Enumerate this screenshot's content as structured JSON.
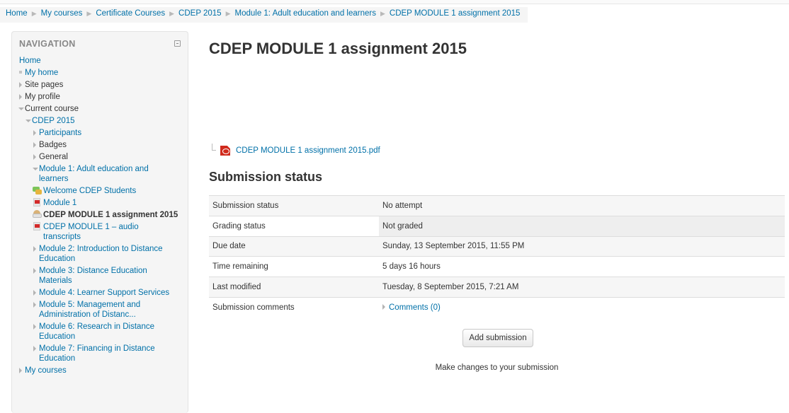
{
  "top": {
    "mini_text": ""
  },
  "breadcrumb": [
    "Home",
    "My courses",
    "Certificate Courses",
    "CDEP 2015",
    "Module 1: Adult education and learners",
    "CDEP MODULE 1 assignment 2015"
  ],
  "navigation": {
    "title": "NAVIGATION",
    "home": "Home",
    "my_home": "My home",
    "site_pages": "Site pages",
    "my_profile": "My profile",
    "current_course": "Current course",
    "course": "CDEP 2015",
    "participants": "Participants",
    "badges": "Badges",
    "general": "General",
    "module1": "Module 1: Adult education and learners",
    "welcome": "Welcome CDEP Students",
    "module1_file": "Module 1",
    "assignment": "CDEP MODULE 1 assignment 2015",
    "audio": "CDEP MODULE 1 – audio transcripts",
    "module2": "Module 2: Introduction to Distance Education",
    "module3": "Module 3: Distance Education Materials",
    "module4": "Module 4: Learner Support Services",
    "module5": "Module 5: Management and Administration of Distanc...",
    "module6": "Module 6: Research in Distance Education",
    "module7": "Module 7: Financing in Distance Education",
    "my_courses": "My courses"
  },
  "main": {
    "title": "CDEP MODULE 1 assignment 2015",
    "file_name": "CDEP MODULE 1 assignment 2015.pdf",
    "section_title": "Submission status",
    "rows": [
      {
        "label": "Submission status",
        "value": "No attempt"
      },
      {
        "label": "Grading status",
        "value": "Not graded"
      },
      {
        "label": "Due date",
        "value": "Sunday, 13 September 2015, 11:55 PM"
      },
      {
        "label": "Time remaining",
        "value": "5 days 16 hours"
      },
      {
        "label": "Last modified",
        "value": "Tuesday, 8 September 2015, 7:21 AM"
      },
      {
        "label": "Submission comments",
        "value": "Comments (0)"
      }
    ],
    "add_submission": "Add submission",
    "help_text": "Make changes to your submission"
  },
  "colors": {
    "link": "#0070a8",
    "block_bg": "#f5f5f5",
    "pdf_red": "#d02b1d"
  }
}
